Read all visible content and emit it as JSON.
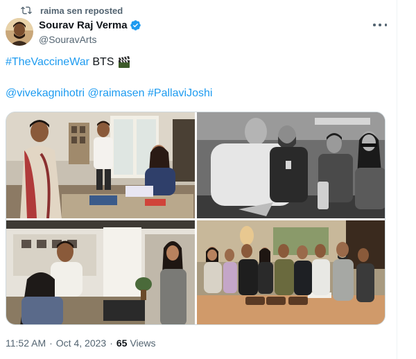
{
  "repost": {
    "text": "raima sen reposted",
    "icon": "repost-icon"
  },
  "author": {
    "name": "Sourav Raj Verma",
    "handle": "@SouravArts",
    "verified": true,
    "verified_color": "#1d9bf0"
  },
  "tweet": {
    "line1": {
      "hashtag": "#TheVaccineWar",
      "text": " BTS",
      "emoji_icon": "clapper-board-icon"
    },
    "line2": {
      "mention1": "@vivekagnihotri",
      "mention2": "@raimasen",
      "hashtag": "#PallaviJoshi"
    }
  },
  "media": {
    "photos": [
      {
        "name": "photo-office-discussion",
        "style": "color"
      },
      {
        "name": "photo-crew-black-and-white",
        "style": "monochrome"
      },
      {
        "name": "photo-desk-scene",
        "style": "color"
      },
      {
        "name": "photo-group-cake-celebration",
        "style": "color"
      }
    ]
  },
  "meta": {
    "time": "11:52 AM",
    "date": "Oct 4, 2023",
    "views_count": "65",
    "views_label": "Views"
  },
  "colors": {
    "link": "#1d9bf0",
    "secondary_text": "#536471",
    "primary_text": "#0f1419",
    "border": "#cfd9de"
  }
}
